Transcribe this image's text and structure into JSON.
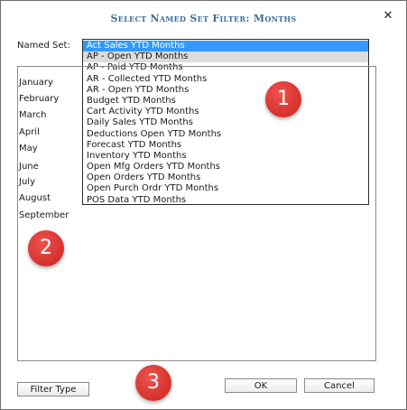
{
  "dialog": {
    "title": "Select Named Set Filter: Months",
    "close_glyph": "✕",
    "close_icon": "close-icon"
  },
  "named_set": {
    "label": "Named Set:",
    "selected_index": 0,
    "hover_index": 1,
    "items": [
      "Act Sales YTD Months",
      "AP - Open YTD Months",
      "AP - Paid YTD Months",
      "AR - Collected YTD Months",
      "AR - Open YTD Months",
      "Budget YTD Months",
      "Cart Activity YTD Months",
      "Daily Sales YTD Months",
      "Deductions Open YTD Months",
      "Forecast YTD Months",
      "Inventory YTD Months",
      "Open Mfg Orders YTD Months",
      "Open Orders YTD Months",
      "Open Purch Ordr YTD Months",
      "POS Data YTD Months"
    ]
  },
  "members": [
    "January",
    "February",
    "March",
    "April",
    "May",
    "June",
    "July",
    "August",
    "September"
  ],
  "badges": [
    "1",
    "2",
    "3"
  ],
  "buttons": {
    "filter_type": "Filter Type",
    "ok": "OK",
    "cancel": "Cancel"
  },
  "colors": {
    "title": "#3d6c9c",
    "selection": "#3399ff",
    "hover": "#dcdcdc",
    "badge": "#d8302b"
  }
}
